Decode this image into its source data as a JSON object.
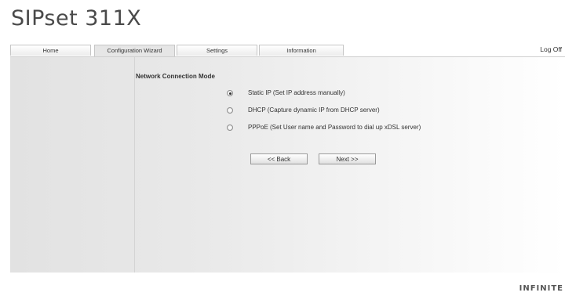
{
  "header": {
    "title": "SIPset 311X"
  },
  "tabs": [
    {
      "label": "Home",
      "active": false
    },
    {
      "label": "Configuration Wizard",
      "active": true
    },
    {
      "label": "Settings",
      "active": false
    },
    {
      "label": "Information",
      "active": false
    }
  ],
  "logoff_label": "Log Off",
  "wizard": {
    "section_title": "Network Connection Mode",
    "options": [
      {
        "label": "Static IP (Set IP address manually)",
        "checked": true
      },
      {
        "label": "DHCP (Capture dynamic IP from DHCP server)",
        "checked": false
      },
      {
        "label": "PPPoE (Set User name and Password to dial up xDSL server)",
        "checked": false
      }
    ],
    "back_label": "<< Back",
    "next_label": "Next >>"
  },
  "footer": {
    "logo_text": "INFINITE"
  }
}
